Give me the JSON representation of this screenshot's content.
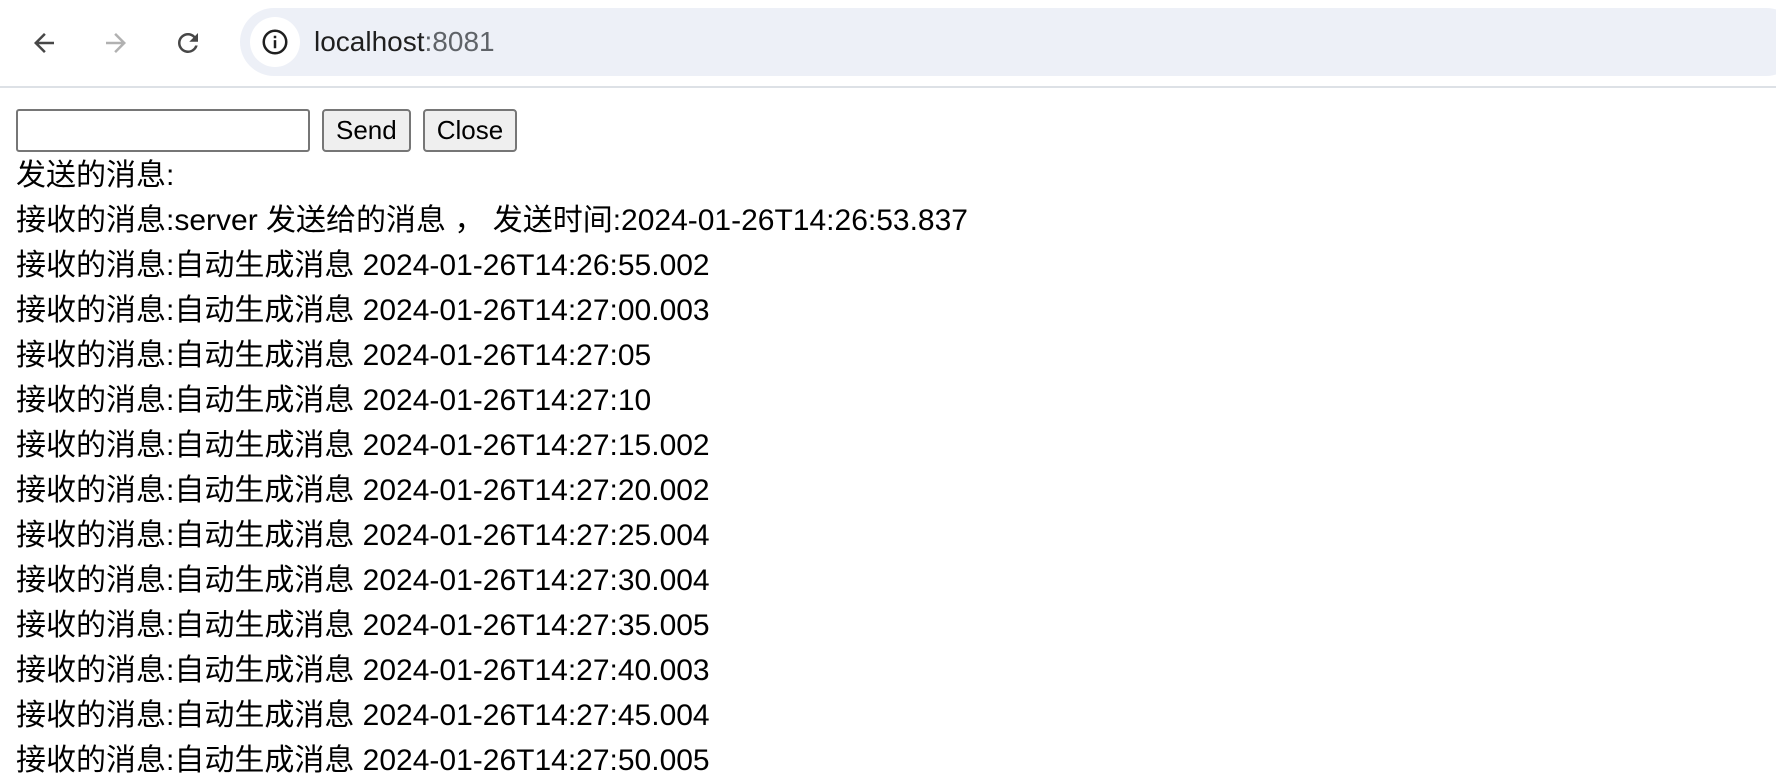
{
  "browser": {
    "url_host": "localhost",
    "url_port": ":8081"
  },
  "page": {
    "input_value": "",
    "send_label": "Send",
    "close_label": "Close",
    "sent_line": "发送的消息:",
    "received_lines": [
      "接收的消息:server 发送给的消息 ， 发送时间:2024-01-26T14:26:53.837",
      "接收的消息:自动生成消息 2024-01-26T14:26:55.002",
      "接收的消息:自动生成消息 2024-01-26T14:27:00.003",
      "接收的消息:自动生成消息 2024-01-26T14:27:05",
      "接收的消息:自动生成消息 2024-01-26T14:27:10",
      "接收的消息:自动生成消息 2024-01-26T14:27:15.002",
      "接收的消息:自动生成消息 2024-01-26T14:27:20.002",
      "接收的消息:自动生成消息 2024-01-26T14:27:25.004",
      "接收的消息:自动生成消息 2024-01-26T14:27:30.004",
      "接收的消息:自动生成消息 2024-01-26T14:27:35.005",
      "接收的消息:自动生成消息 2024-01-26T14:27:40.003",
      "接收的消息:自动生成消息 2024-01-26T14:27:45.004",
      "接收的消息:自动生成消息 2024-01-26T14:27:50.005"
    ]
  },
  "icons": {
    "back": "arrow-left-icon",
    "forward": "arrow-right-icon",
    "reload": "reload-icon",
    "site_info": "info-icon"
  },
  "colors": {
    "toolbar_icon": "#474747",
    "forward_disabled": "#b1b1b1",
    "omnibox_bg": "#edf0f7"
  }
}
